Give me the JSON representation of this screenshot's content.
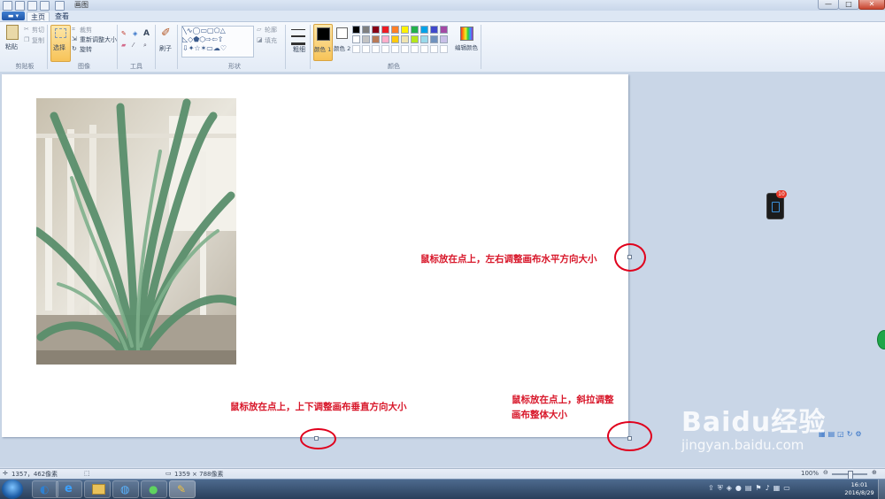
{
  "window": {
    "title": "画图",
    "minimize_label": "—",
    "maximize_label": "□",
    "close_label": "✕"
  },
  "tabs": {
    "app_menu": "▬ ▾",
    "home": "主页",
    "view": "查看"
  },
  "ribbon": {
    "clipboard": {
      "paste": "粘贴",
      "cut": "剪切",
      "copy": "复制",
      "label": "剪贴板"
    },
    "image": {
      "select": "选择",
      "crop": "裁剪",
      "resize": "重新调整大小",
      "rotate": "旋转",
      "label": "图像"
    },
    "tools": {
      "label": "工具"
    },
    "brushes": {
      "label": "刷子"
    },
    "shapes": {
      "outline": "轮廓",
      "fill": "填充",
      "label": "形状"
    },
    "size": {
      "label": "粗细"
    },
    "colors": {
      "color1": "颜色 1",
      "color2": "颜色 2",
      "edit": "编辑颜色",
      "label": "颜色",
      "palette_row1": [
        "#000000",
        "#7f7f7f",
        "#880015",
        "#ed1c24",
        "#ff7f27",
        "#fff200",
        "#22b14c",
        "#00a2e8",
        "#3f48cc",
        "#a349a4"
      ],
      "palette_row2": [
        "#ffffff",
        "#c3c3c3",
        "#b97a57",
        "#ffaec9",
        "#ffc90e",
        "#efe4b0",
        "#b5e61d",
        "#99d9ea",
        "#7092be",
        "#c8bfe7"
      ]
    }
  },
  "annotations": {
    "horizontal": "鼠标放在点上，左右调整画布水平方向大小",
    "vertical": "鼠标放在点上，上下调整画布垂直方向大小",
    "diagonal_line1": "鼠标放在点上，斜拉调整",
    "diagonal_line2": "画布整体大小"
  },
  "status": {
    "cursor": "1357，462像素",
    "canvas_size": "1359 × 788像素",
    "zoom": "100%"
  },
  "taskbar": {
    "clock_time": "16:01",
    "clock_date": "2016/8/29"
  },
  "watermark": {
    "brand": "Baidu经验",
    "url": "jingyan.baidu.com"
  },
  "notification_badge": "10"
}
